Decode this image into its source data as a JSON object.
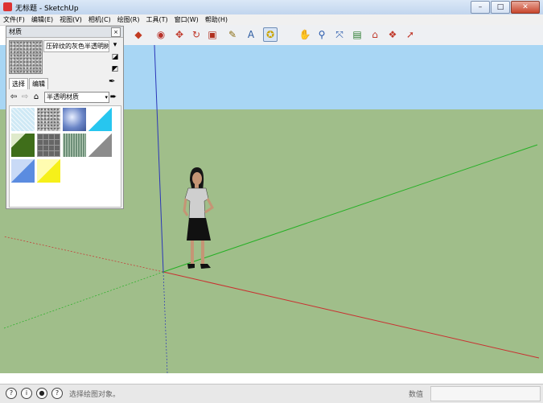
{
  "window": {
    "title": "无标题 - SketchUp",
    "minimize": "–",
    "maximize": "□",
    "close": "✕"
  },
  "menu": [
    "文件(F)",
    "编辑(E)",
    "视图(V)",
    "相机(C)",
    "绘图(R)",
    "工具(T)",
    "窗口(W)",
    "帮助(H)"
  ],
  "toolbar": {
    "tools": [
      {
        "name": "push-pull-icon",
        "glyph": "◆",
        "color": "#c23b22"
      },
      {
        "name": "follow-me-icon",
        "glyph": "◉",
        "color": "#b8322a"
      },
      {
        "name": "move-icon",
        "glyph": "✥",
        "color": "#c0392b"
      },
      {
        "name": "rotate-icon",
        "glyph": "↻",
        "color": "#c0392b"
      },
      {
        "name": "scale-icon",
        "glyph": "▣",
        "color": "#b03020"
      },
      {
        "name": "tape-measure-icon",
        "glyph": "✎",
        "color": "#8a6d12"
      },
      {
        "name": "text-icon",
        "glyph": "A",
        "color": "#2b5aa0"
      },
      {
        "name": "paint-bucket-icon",
        "glyph": "✪",
        "color": "#c9a300",
        "active": true
      },
      {
        "name": "orbit-icon",
        "glyph": "✋",
        "color": "#444444"
      },
      {
        "name": "zoom-icon",
        "glyph": "⚲",
        "color": "#2255aa"
      },
      {
        "name": "zoom-extents-icon",
        "glyph": "⤧",
        "color": "#2255aa"
      },
      {
        "name": "photo-textures-icon",
        "glyph": "▤",
        "color": "#2e7d32"
      },
      {
        "name": "warehouse-icon",
        "glyph": "⌂",
        "color": "#c0392b"
      },
      {
        "name": "components-icon",
        "glyph": "❖",
        "color": "#c0392b"
      },
      {
        "name": "share-model-icon",
        "glyph": "➚",
        "color": "#c0392b"
      }
    ]
  },
  "materials_panel": {
    "title": "材质",
    "close": "×",
    "current_material": "压碎纹的灰色半透明树",
    "tabs": [
      "选择",
      "编辑"
    ],
    "library": "半透明材质"
  },
  "swatches": [
    {
      "name": "swatch-translucent-glass-light-blue"
    },
    {
      "name": "swatch-translucent-crushed-gray"
    },
    {
      "name": "swatch-translucent-blue-sky"
    },
    {
      "name": "swatch-translucent-cyan"
    },
    {
      "name": "swatch-translucent-green"
    },
    {
      "name": "swatch-translucent-gray-tile"
    },
    {
      "name": "swatch-translucent-reed"
    },
    {
      "name": "swatch-translucent-gray"
    },
    {
      "name": "swatch-translucent-blue"
    },
    {
      "name": "swatch-translucent-yellow"
    }
  ],
  "status": {
    "hint": "选择绘图对象。",
    "value_label": "数值"
  },
  "colors": {
    "sky": "#a8d6f4",
    "ground": "#a0be8a",
    "axis_red": "#c93030",
    "axis_green": "#26b026",
    "axis_blue": "#2a36b8"
  }
}
